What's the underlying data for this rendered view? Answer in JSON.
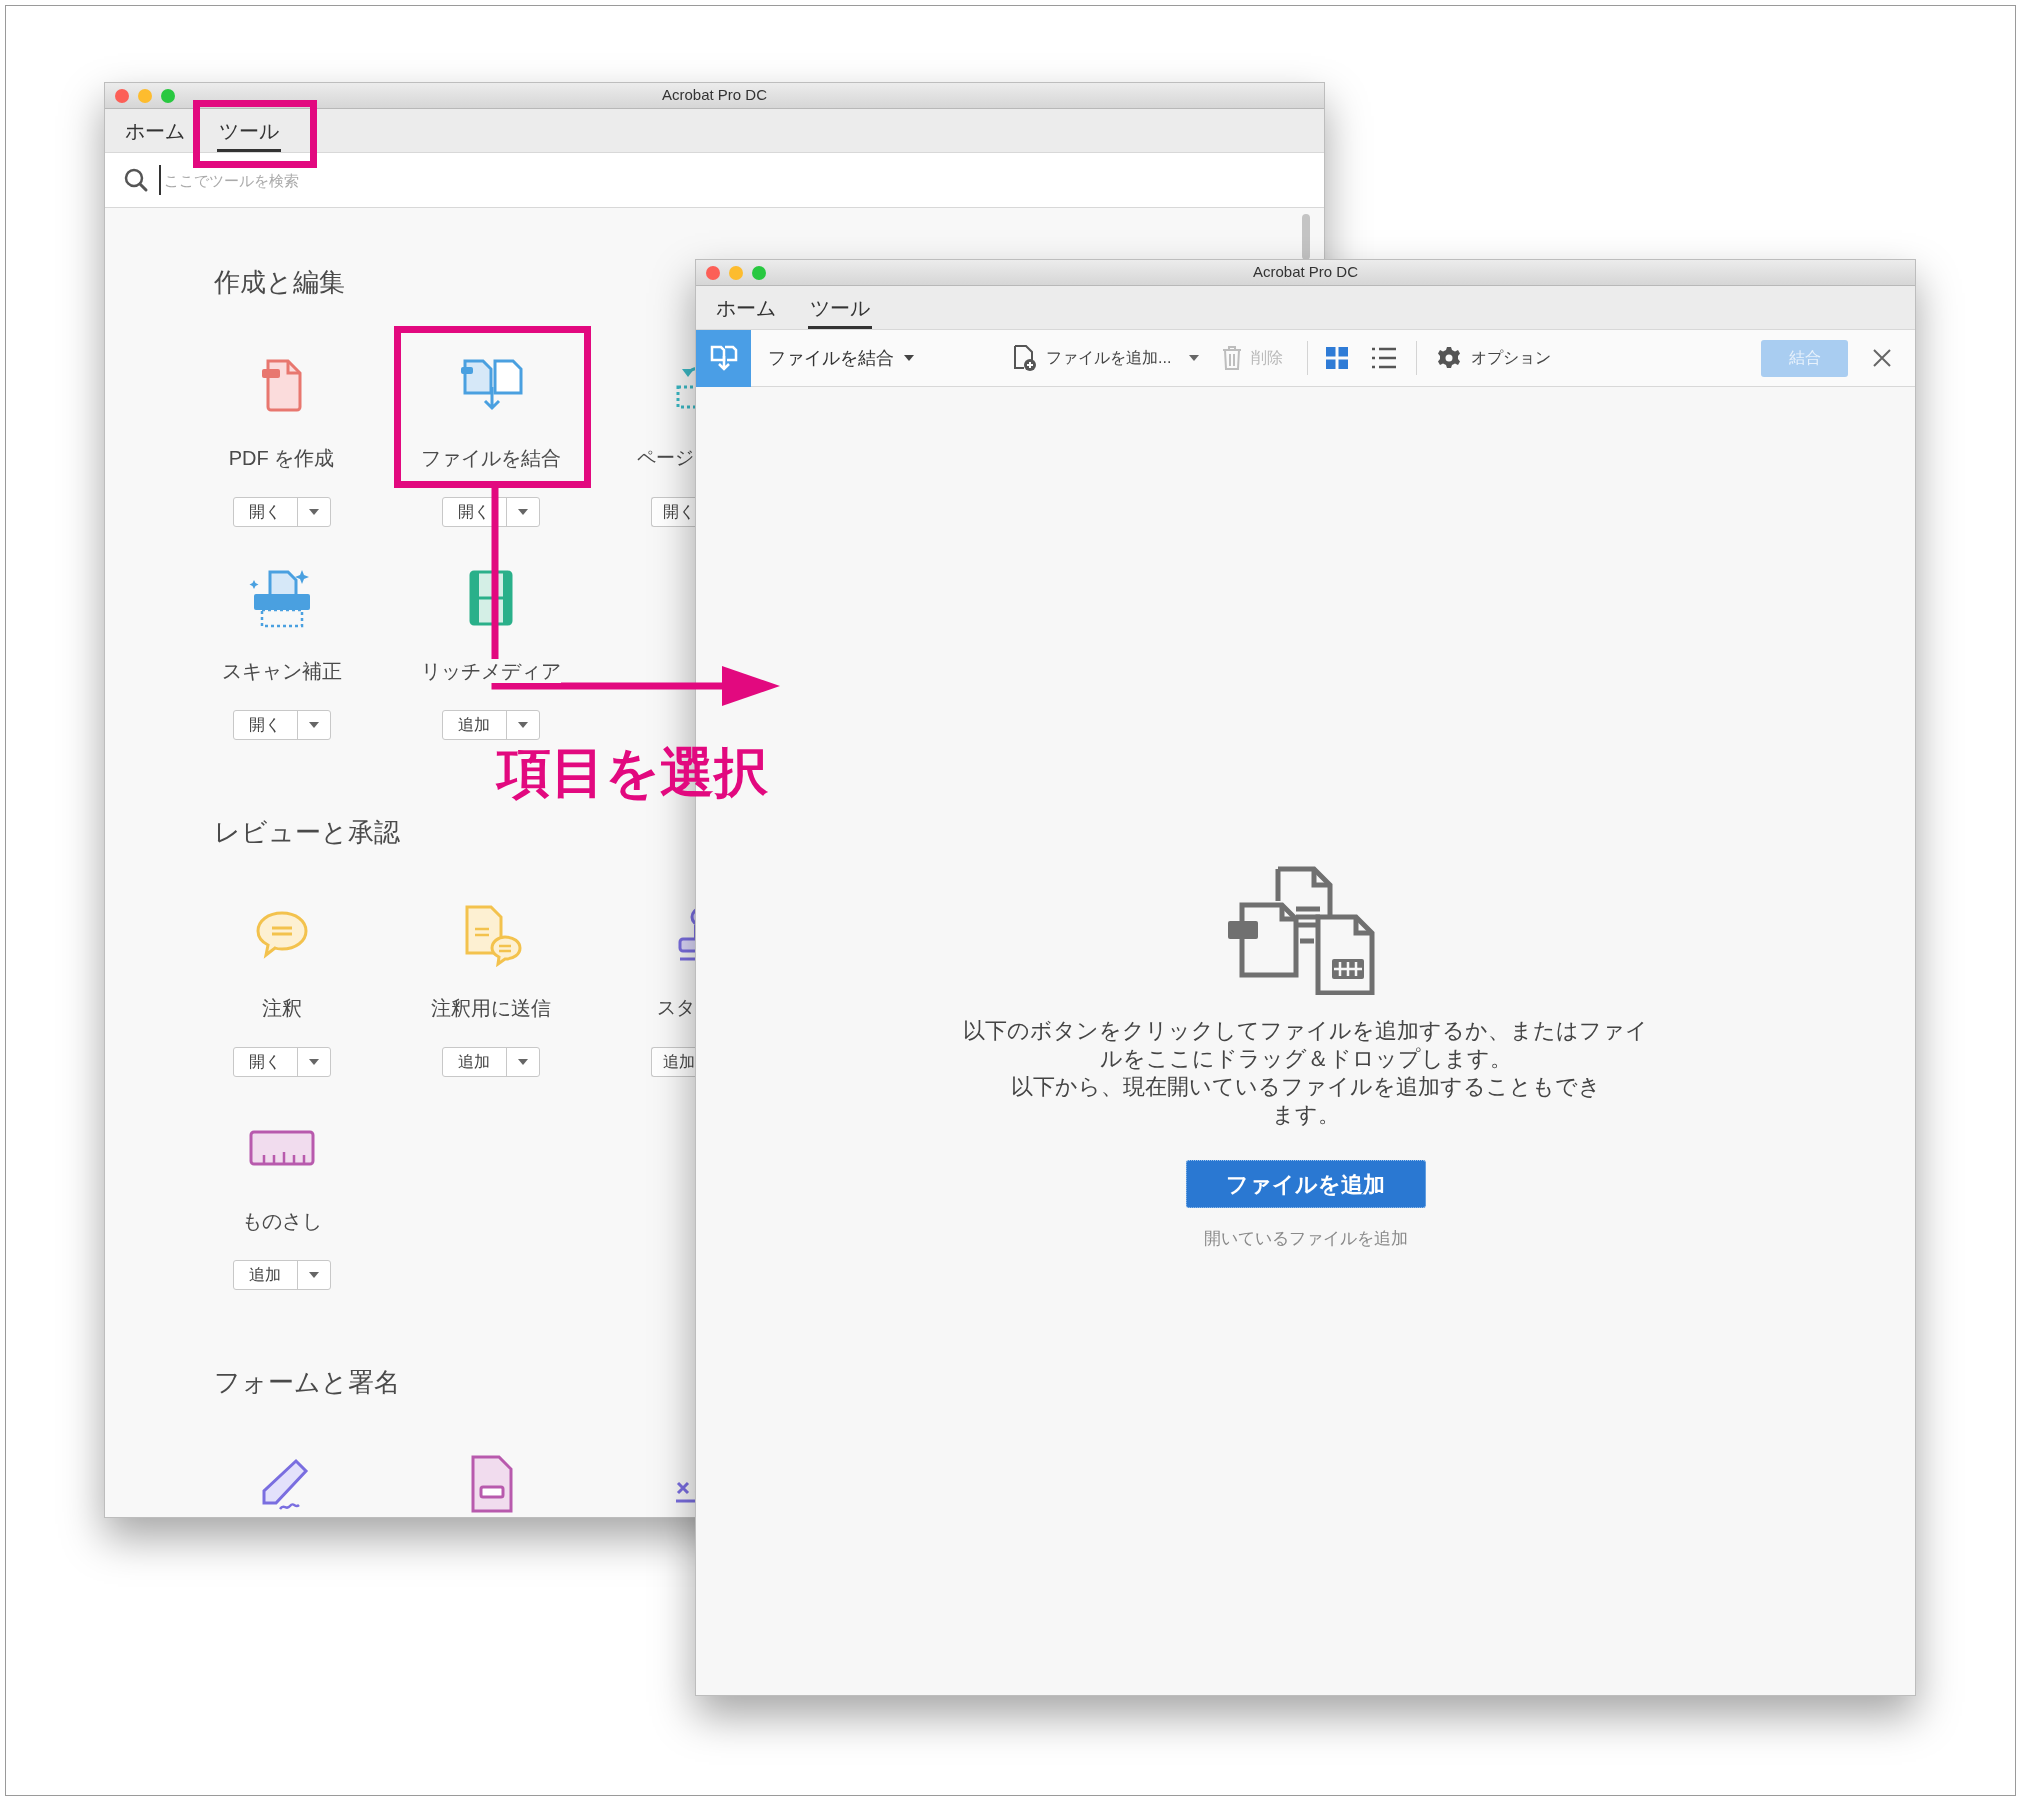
{
  "back_window": {
    "title": "Acrobat Pro DC",
    "tabs": [
      {
        "label": "ホーム",
        "selected": false
      },
      {
        "label": "ツール",
        "selected": true
      }
    ],
    "search": {
      "placeholder": "ここでツールを検索"
    },
    "sections": [
      {
        "title": "作成と編集",
        "tools": [
          {
            "kind": "labelled",
            "label": "PDF を作成",
            "button": "開く"
          },
          {
            "kind": "labelled",
            "label": "ファイルを結合",
            "button": "開く"
          },
          {
            "kind": "labelled",
            "label": "ページ",
            "button": "開く"
          },
          {
            "kind": "labelled",
            "label": "スキャン補正",
            "button": "開く"
          },
          {
            "kind": "labelled",
            "label": "リッチメディア",
            "button": "追加"
          }
        ]
      },
      {
        "title": "レビューと承認",
        "tools": [
          {
            "kind": "labelled",
            "label": "注釈",
            "button": "開く"
          },
          {
            "kind": "labelled",
            "label": "注釈用に送信",
            "button": "追加"
          },
          {
            "kind": "labelled",
            "label": "スタ",
            "button": "追加"
          },
          {
            "kind": "labelled",
            "label": "ものさし",
            "button": "追加"
          }
        ]
      },
      {
        "title": "フォームと署名",
        "tools": [
          {
            "kind": "icon_only"
          },
          {
            "kind": "icon_only"
          },
          {
            "kind": "icon_only"
          }
        ]
      }
    ]
  },
  "front_window": {
    "title": "Acrobat Pro DC",
    "tabs": [
      {
        "label": "ホーム",
        "selected": false
      },
      {
        "label": "ツール",
        "selected": true
      }
    ],
    "toolbar": {
      "tool_name": "ファイルを結合",
      "add_files": "ファイルを追加...",
      "delete": {
        "label": "削除",
        "disabled": true
      },
      "views": [
        {
          "kind": "grid",
          "selected": true
        },
        {
          "kind": "list",
          "selected": false
        }
      ],
      "options": "オプション",
      "combine": {
        "label": "結合",
        "disabled": true
      }
    },
    "drop_zone": {
      "messages": [
        "以下のボタンをクリックしてファイルを追加するか、またはファイルをここにドラッグ＆ドロップします。",
        "以下から、現在開いているファイルを追加することもできます。"
      ],
      "button": "ファイルを追加",
      "link": "開いているファイルを追加"
    }
  },
  "annotation": {
    "label": "項目を選択"
  }
}
